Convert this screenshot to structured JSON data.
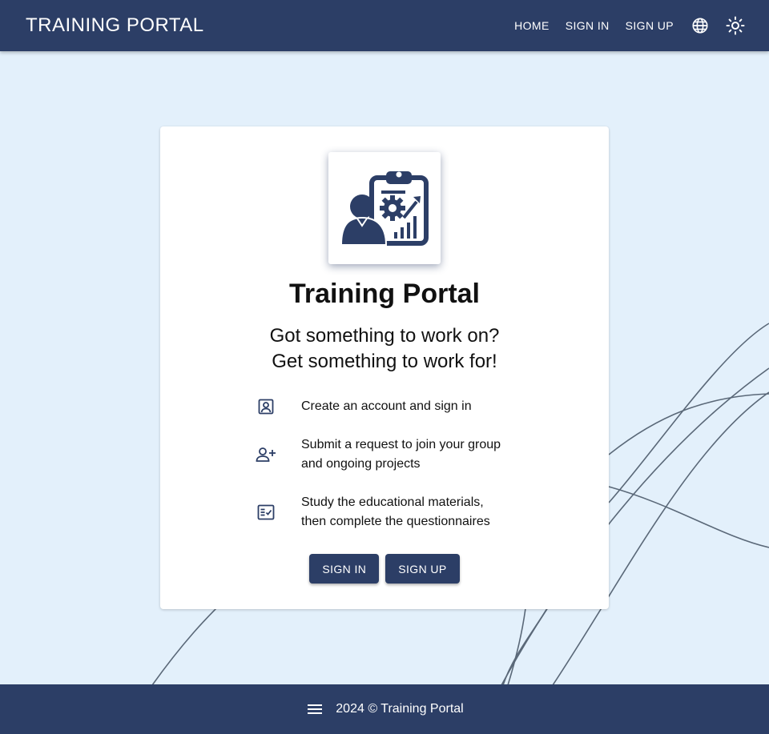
{
  "header": {
    "brand": "TRAINING PORTAL",
    "nav": {
      "home": "HOME",
      "sign_in": "SIGN IN",
      "sign_up": "SIGN UP"
    },
    "icons": {
      "language": "globe-icon",
      "theme": "sun-icon"
    }
  },
  "card": {
    "logo_icon": "training-clipboard-icon",
    "title": "Training Portal",
    "slogan_line1": "Got something to work on?",
    "slogan_line2": "Get something to work for!",
    "steps": [
      {
        "icon": "account-box-icon",
        "line1": "Create an account and sign in",
        "line2": ""
      },
      {
        "icon": "person-add-icon",
        "line1": "Submit a request to join your group",
        "line2": "and ongoing projects"
      },
      {
        "icon": "fact-check-icon",
        "line1": "Study the educational materials,",
        "line2": "then complete the questionnaires"
      }
    ],
    "buttons": {
      "sign_in": "SIGN IN",
      "sign_up": "SIGN UP"
    }
  },
  "footer": {
    "menu_icon": "menu-icon",
    "text": "2024 © Training Portal"
  },
  "colors": {
    "primary": "#2c3e66",
    "background": "#e3f0fb",
    "card": "#ffffff"
  }
}
